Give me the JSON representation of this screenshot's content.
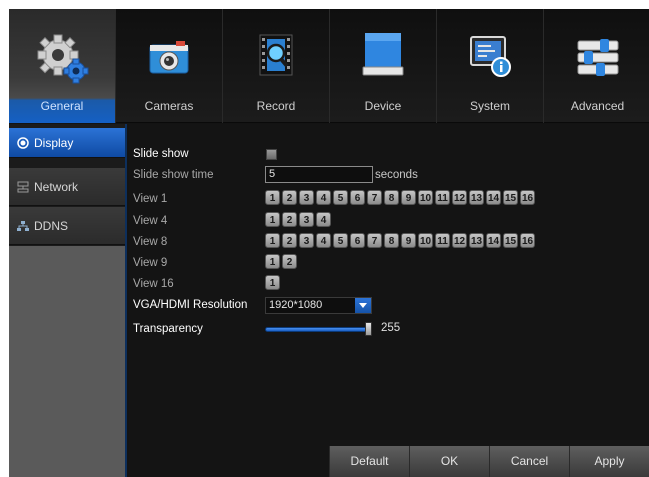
{
  "nav": [
    {
      "label": "General",
      "icon": "gears-icon",
      "active": true
    },
    {
      "label": "Cameras",
      "icon": "camera-icon",
      "active": false
    },
    {
      "label": "Record",
      "icon": "film-search-icon",
      "active": false
    },
    {
      "label": "Device",
      "icon": "hard-drive-icon",
      "active": false
    },
    {
      "label": "System",
      "icon": "system-info-icon",
      "active": false
    },
    {
      "label": "Advanced",
      "icon": "sliders-icon",
      "active": false
    }
  ],
  "sidebar": {
    "items": [
      {
        "label": "Display",
        "icon": "radio-dot-icon",
        "active": true
      },
      {
        "label": "Network",
        "icon": "network-icon",
        "active": false
      },
      {
        "label": "DDNS",
        "icon": "ddns-icon",
        "active": false
      }
    ]
  },
  "settings": {
    "slide_show": {
      "label": "Slide show",
      "checked": false
    },
    "slide_show_time": {
      "label": "Slide show time",
      "value": "5",
      "unit": "seconds"
    },
    "view1": {
      "label": "View 1",
      "channels": [
        "1",
        "2",
        "3",
        "4",
        "5",
        "6",
        "7",
        "8",
        "9",
        "10",
        "11",
        "12",
        "13",
        "14",
        "15",
        "16"
      ]
    },
    "view4": {
      "label": "View 4",
      "channels": [
        "1",
        "2",
        "3",
        "4"
      ]
    },
    "view8": {
      "label": "View 8",
      "channels": [
        "1",
        "2",
        "3",
        "4",
        "5",
        "6",
        "7",
        "8",
        "9",
        "10",
        "11",
        "12",
        "13",
        "14",
        "15",
        "16"
      ]
    },
    "view9": {
      "label": "View 9",
      "channels": [
        "1",
        "2"
      ]
    },
    "view16": {
      "label": "View 16",
      "channels": [
        "1"
      ]
    },
    "resolution": {
      "label": "VGA/HDMI Resolution",
      "value": "1920*1080"
    },
    "transparency": {
      "label": "Transparency",
      "value": "255",
      "level": 1.0
    }
  },
  "buttons": {
    "default": "Default",
    "ok": "OK",
    "cancel": "Cancel",
    "apply": "Apply"
  },
  "colors": {
    "accent": "#1560c4",
    "background": "#141414"
  }
}
